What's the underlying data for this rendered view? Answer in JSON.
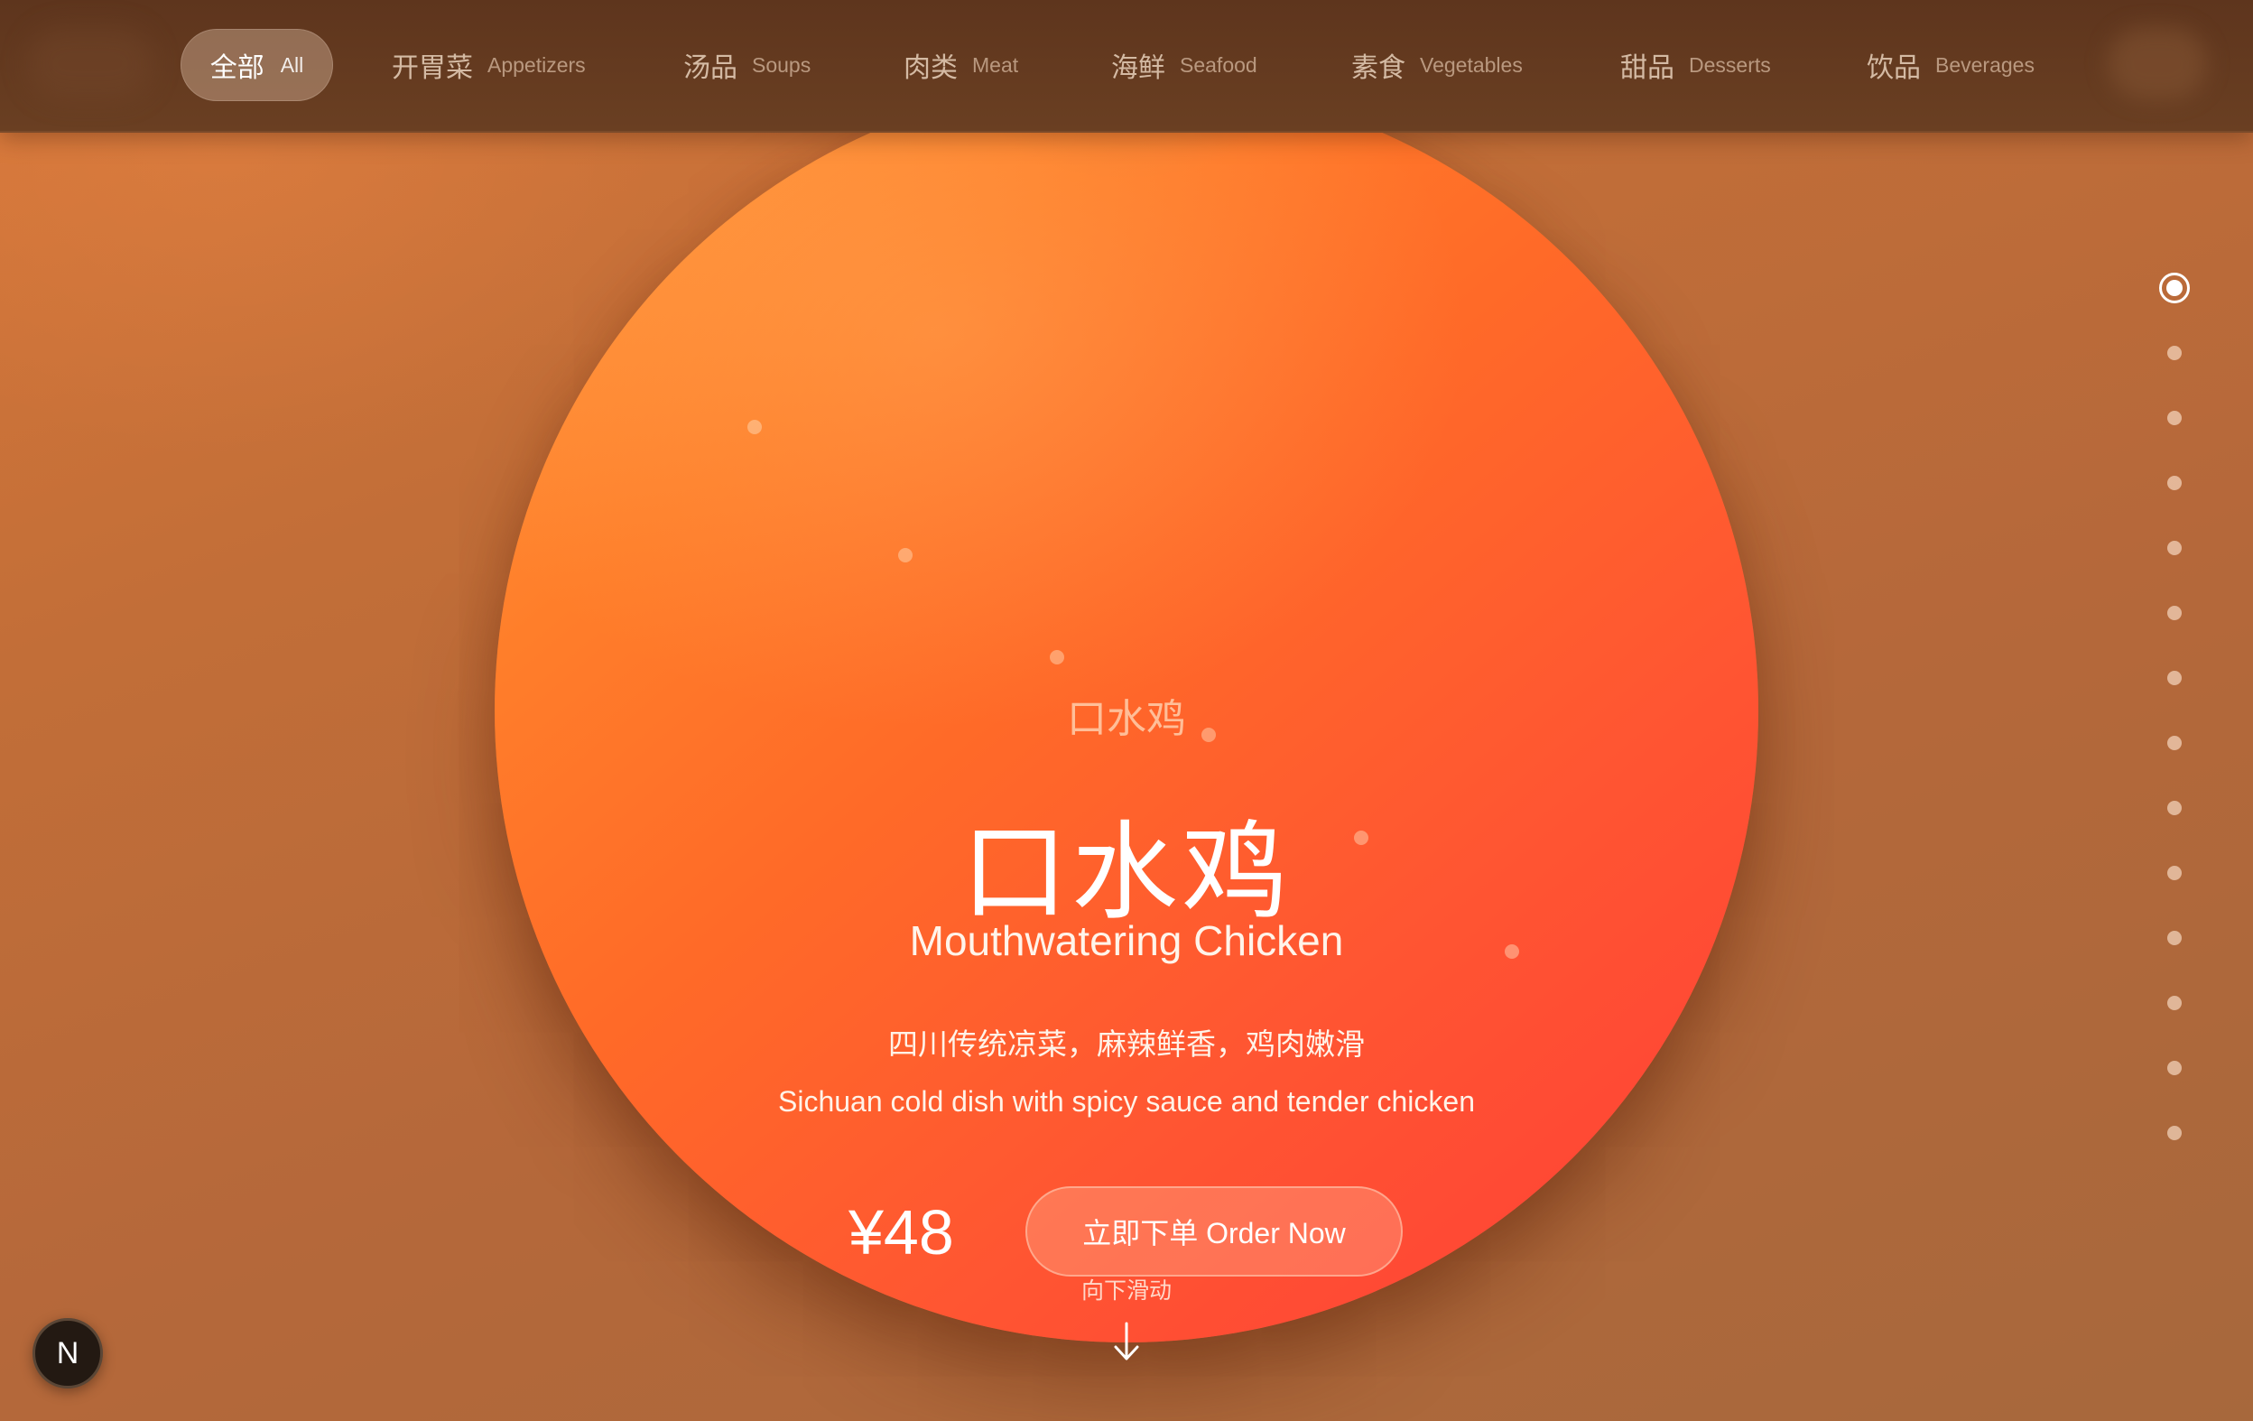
{
  "nav": {
    "tabs": [
      {
        "zh": "全部",
        "en": "All"
      },
      {
        "zh": "开胃菜",
        "en": "Appetizers"
      },
      {
        "zh": "汤品",
        "en": "Soups"
      },
      {
        "zh": "肉类",
        "en": "Meat"
      },
      {
        "zh": "海鲜",
        "en": "Seafood"
      },
      {
        "zh": "素食",
        "en": "Vegetables"
      },
      {
        "zh": "甜品",
        "en": "Desserts"
      },
      {
        "zh": "饮品",
        "en": "Beverages"
      }
    ],
    "active_index": 0
  },
  "dish": {
    "name_small": "口水鸡",
    "name_zh": "口水鸡",
    "name_en": "Mouthwatering Chicken",
    "desc_zh": "四川传统凉菜，麻辣鲜香，鸡肉嫩滑",
    "desc_en": "Sichuan cold dish with spicy sauce and tender chicken",
    "price": "¥48",
    "order_label": "立即下单 Order Now"
  },
  "scroll_hint": "向下滑动",
  "pagination": {
    "total": 14,
    "active_index": 0
  },
  "badge": {
    "letter": "N"
  },
  "icons": {
    "scroll": "arrow-down-icon"
  },
  "colors": {
    "circle_start": "#ff9a3e",
    "circle_end": "#ff3e36",
    "nav_bg": "#5e351d",
    "page_bg": "#c26e38"
  }
}
